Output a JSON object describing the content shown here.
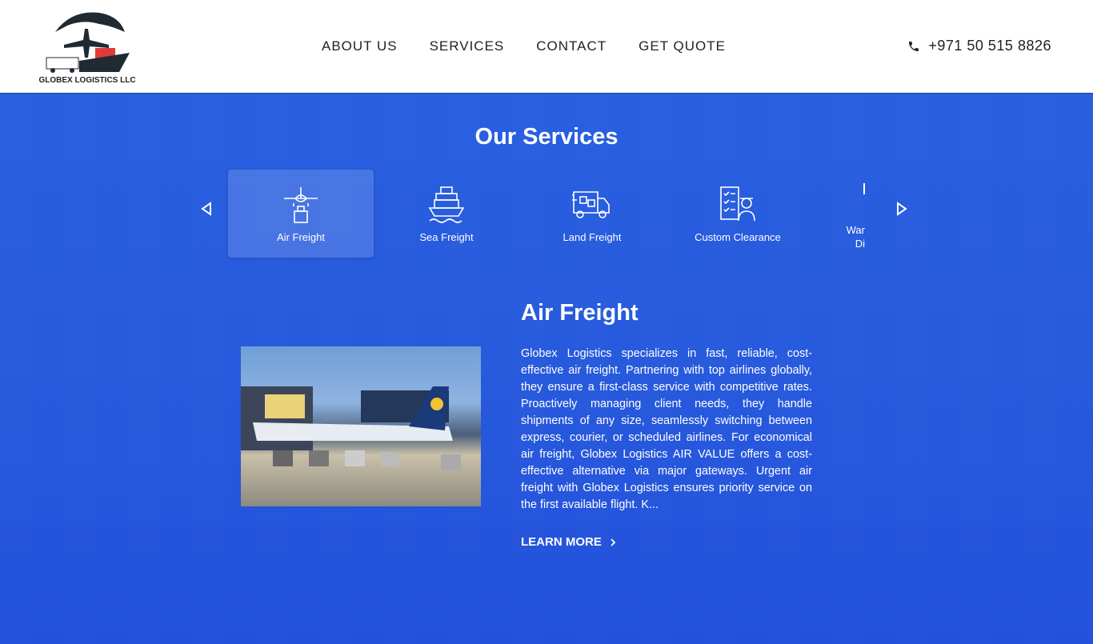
{
  "header": {
    "logo_text": "GLOBEX LOGISTICS LLC",
    "nav": [
      "ABOUT US",
      "SERVICES",
      "CONTACT",
      "GET QUOTE"
    ],
    "phone": "+971 50 515 8826"
  },
  "services": {
    "title": "Our Services",
    "tabs": [
      {
        "label": "Air Freight",
        "icon": "airplane-icon"
      },
      {
        "label": "Sea Freight",
        "icon": "ship-icon"
      },
      {
        "label": "Land Freight",
        "icon": "truck-icon"
      },
      {
        "label": "Custom Clearance",
        "icon": "clearance-icon"
      },
      {
        "label": "War\nDi",
        "icon": "warehouse-icon"
      }
    ],
    "active": 0
  },
  "detail": {
    "title": "Air Freight",
    "description": "Globex Logistics specializes in fast, reliable, cost-effective air freight. Partnering with top airlines globally, they ensure a first-class service with competitive rates. Proactively managing client needs, they handle shipments of any size, seamlessly switching between express, courier, or scheduled airlines. For economical air freight, Globex Logistics AIR VALUE offers a cost-effective alternative via major gateways. Urgent air freight with Globex Logistics ensures priority service on the first available flight. K...",
    "learn_more": "LEARN MORE"
  },
  "colors": {
    "background": "#2a5de0",
    "header": "#ffffff",
    "logo_red": "#e03a3a"
  }
}
